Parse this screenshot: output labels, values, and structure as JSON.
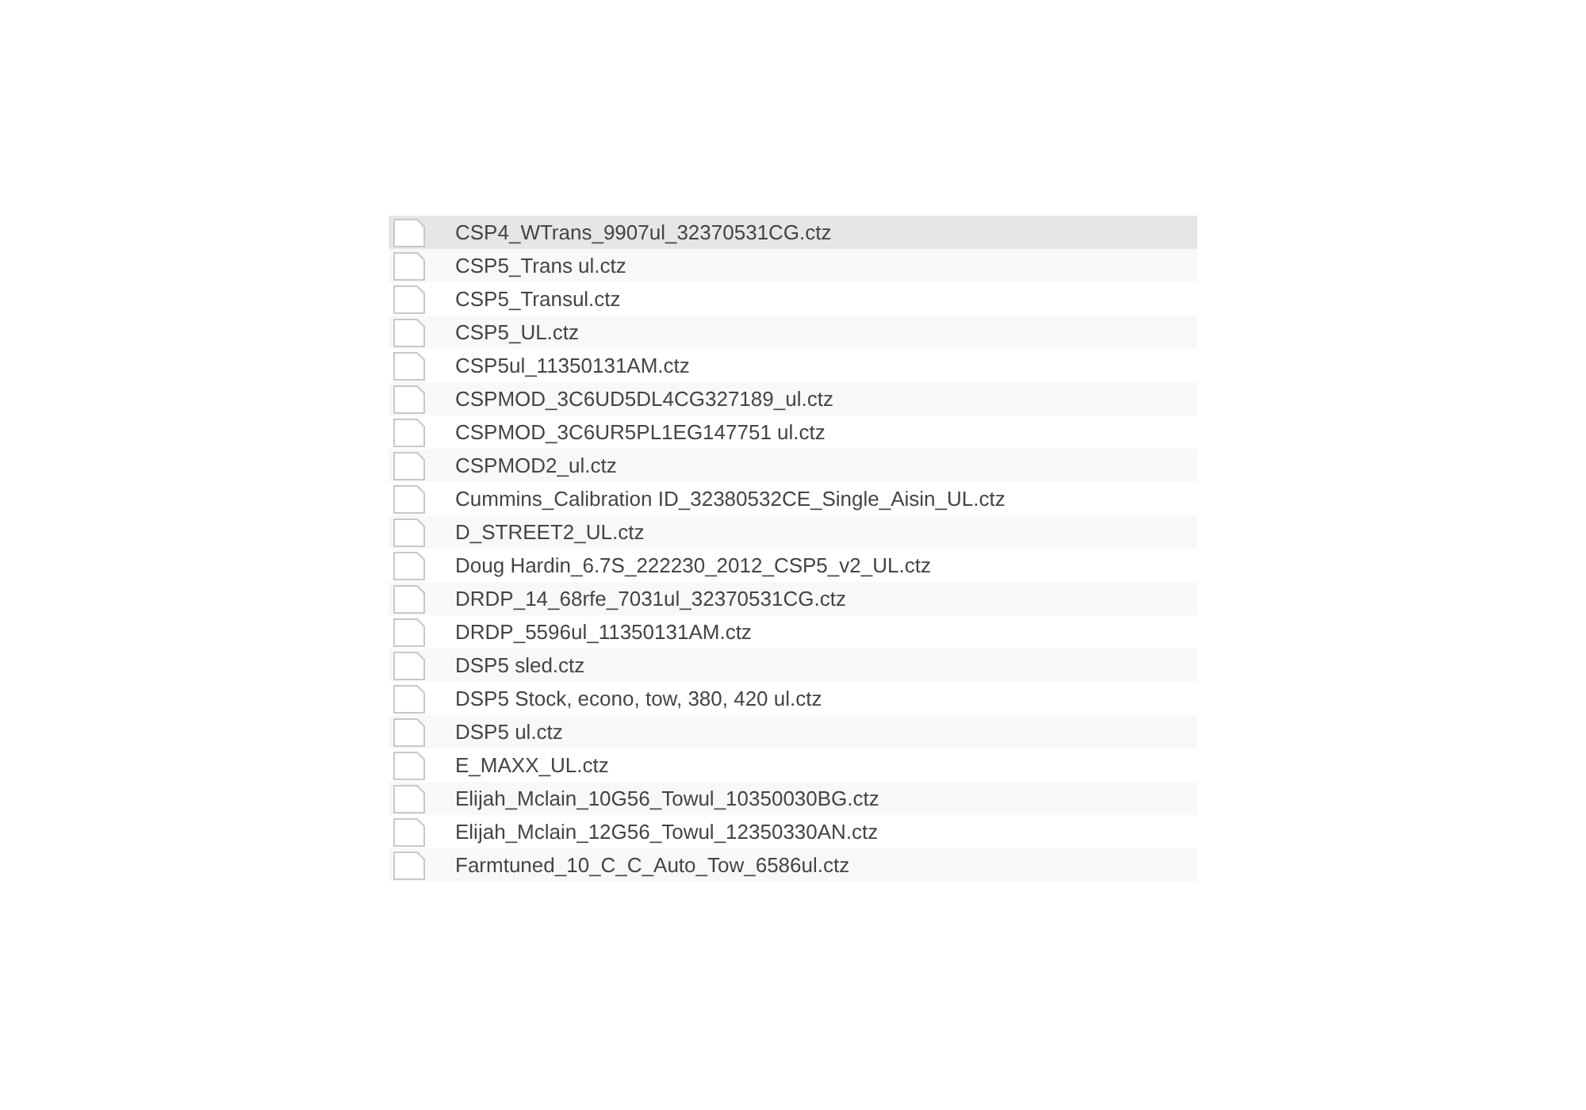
{
  "files": [
    {
      "name": "CSP4_WTrans_9907ul_32370531CG.ctz",
      "selected": true
    },
    {
      "name": "CSP5_Trans ul.ctz",
      "selected": false
    },
    {
      "name": "CSP5_Transul.ctz",
      "selected": false
    },
    {
      "name": "CSP5_UL.ctz",
      "selected": false
    },
    {
      "name": "CSP5ul_11350131AM.ctz",
      "selected": false
    },
    {
      "name": "CSPMOD_3C6UD5DL4CG327189_ul.ctz",
      "selected": false
    },
    {
      "name": "CSPMOD_3C6UR5PL1EG147751 ul.ctz",
      "selected": false
    },
    {
      "name": "CSPMOD2_ul.ctz",
      "selected": false
    },
    {
      "name": "Cummins_Calibration ID_32380532CE_Single_Aisin_UL.ctz",
      "selected": false
    },
    {
      "name": "D_STREET2_UL.ctz",
      "selected": false
    },
    {
      "name": "Doug Hardin_6.7S_222230_2012_CSP5_v2_UL.ctz",
      "selected": false
    },
    {
      "name": "DRDP_14_68rfe_7031ul_32370531CG.ctz",
      "selected": false
    },
    {
      "name": "DRDP_5596ul_11350131AM.ctz",
      "selected": false
    },
    {
      "name": "DSP5 sled.ctz",
      "selected": false
    },
    {
      "name": "DSP5 Stock, econo, tow, 380, 420 ul.ctz",
      "selected": false
    },
    {
      "name": "DSP5 ul.ctz",
      "selected": false
    },
    {
      "name": "E_MAXX_UL.ctz",
      "selected": false
    },
    {
      "name": "Elijah_Mclain_10G56_Towul_10350030BG.ctz",
      "selected": false
    },
    {
      "name": "Elijah_Mclain_12G56_Towul_12350330AN.ctz",
      "selected": false
    },
    {
      "name": "Farmtuned_10_C_C_Auto_Tow_6586ul.ctz",
      "selected": false
    }
  ]
}
